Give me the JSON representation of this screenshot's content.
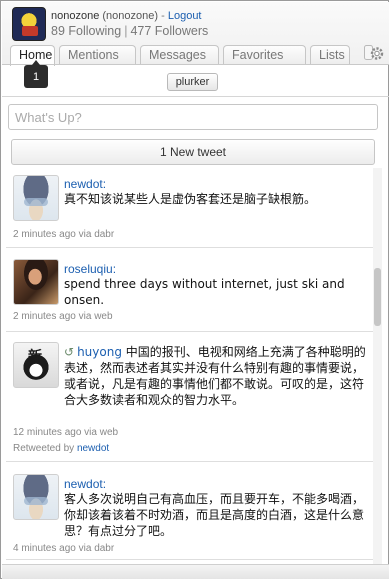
{
  "profile": {
    "username": "nonozone",
    "handle": "(nonozone)",
    "separator": "-",
    "logout_label": "Logout",
    "following": "89 Following",
    "pipe": "|",
    "followers": "477 Followers"
  },
  "tabs": [
    {
      "label": "Home",
      "active": true
    },
    {
      "label": "Mentions"
    },
    {
      "label": "Messages"
    },
    {
      "label": "Favorites"
    },
    {
      "label": "Lists"
    }
  ],
  "tooltip": {
    "text": "1"
  },
  "toolbar": {
    "plurker_label": "plurker"
  },
  "compose": {
    "placeholder": "What's Up?"
  },
  "new_tweet_label": "1 New tweet",
  "timeline": [
    {
      "user": "newdot:",
      "text": "真不知该说某些人是虚伪客套还是脑子缺根筋。",
      "time": "2 minutes ago",
      "via_word": "via",
      "via": "dabr",
      "avatar_icon": "anime-avatar"
    },
    {
      "user": "roseluqiu:",
      "text": "spend three days without internet, just ski and onsen.",
      "time": "2 minutes ago",
      "via_word": "via",
      "via": "web",
      "avatar_icon": "photo-avatar"
    },
    {
      "user": "huyong",
      "retweet": true,
      "text": "中国的报刊、电视和网络上充满了各种聪明的表述，然而表述者其实并没有什么特别有趣的事情要说，或者说，凡是有趣的事情他们都不敢说。可叹的是，这符合大多数读者和观众的智力水平。",
      "time": "12 minutes ago",
      "via_word": "via",
      "via": "web",
      "retweeted_by_label": "Retweeted by",
      "retweeted_by": "newdot",
      "avatar_icon": "badge-avatar"
    },
    {
      "user": "newdot:",
      "text": "客人多次说明自己有高血压，而且要开车，不能多喝酒，你却该着该着不时劝酒，而且是高度的白酒，这是什么意思？有点过分了吧。",
      "time": "4 minutes ago",
      "via_word": "via",
      "via": "dabr",
      "avatar_icon": "anime-avatar"
    }
  ],
  "colors": {
    "link": "#1c5fb0",
    "meta": "#888888",
    "tab_border": "#c6c6c6"
  },
  "icons": {
    "settings": "gear-icon",
    "retweet": "retweet-icon"
  }
}
